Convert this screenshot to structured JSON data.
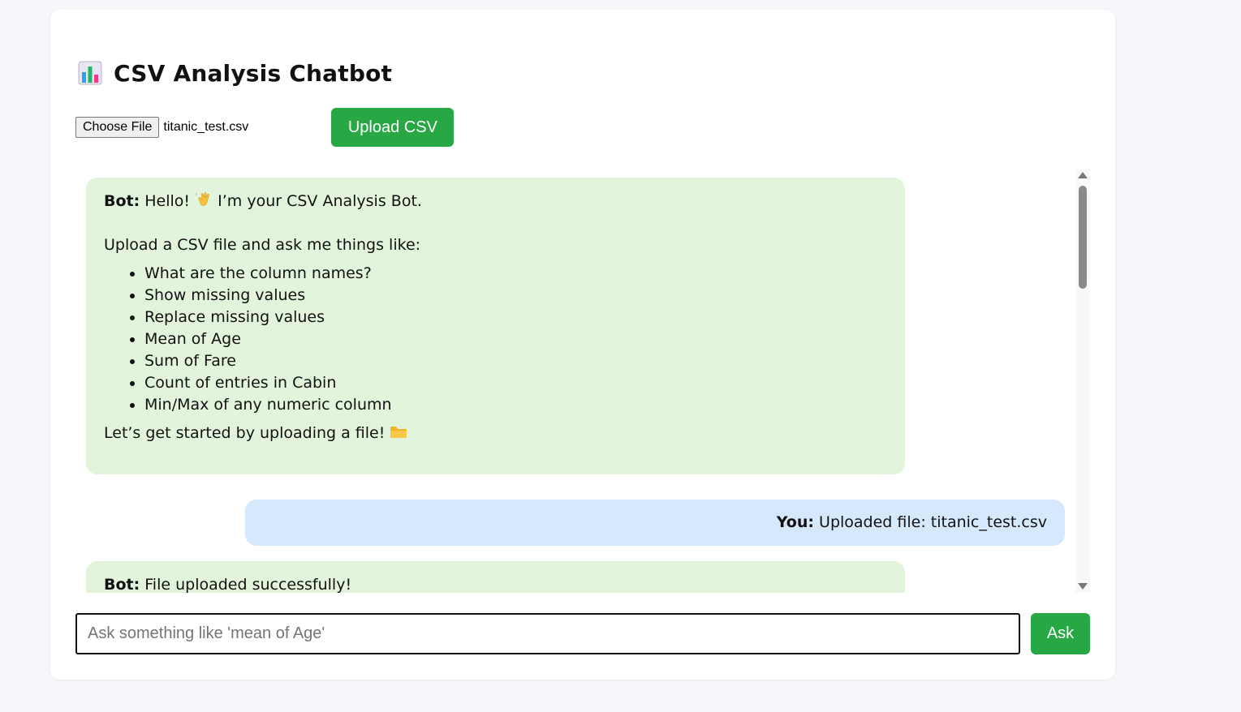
{
  "app": {
    "title": "CSV Analysis Chatbot",
    "title_icon": "bar-chart-icon"
  },
  "upload": {
    "choose_file_label": "Choose File",
    "file_name": "titanic_test.csv",
    "upload_button_label": "Upload CSV"
  },
  "chat": {
    "messages": [
      {
        "role": "bot",
        "speaker": "Bot:",
        "greeting": "Hello!",
        "greeting_icon": "waving-hand-icon",
        "greeting_rest": "I’m your CSV Analysis Bot.",
        "intro": "Upload a CSV file and ask me things like:",
        "items": [
          "What are the column names?",
          "Show missing values",
          "Replace missing values",
          "Mean of Age",
          "Sum of Fare",
          "Count of entries in Cabin",
          "Min/Max of any numeric column"
        ],
        "outro": "Let’s get started by uploading a file!",
        "outro_icon": "folder-icon"
      },
      {
        "role": "user",
        "speaker": "You:",
        "text": "Uploaded file: titanic_test.csv"
      },
      {
        "role": "bot",
        "speaker": "Bot:",
        "text": "File uploaded successfully!"
      }
    ]
  },
  "input": {
    "value": "",
    "placeholder": "Ask something like 'mean of Age'",
    "ask_button_label": "Ask"
  },
  "colors": {
    "accent_green": "#28a745",
    "bot_bubble": "#e2f5dc",
    "user_bubble": "#d6e8fb",
    "page_background": "#f5f7fb"
  }
}
